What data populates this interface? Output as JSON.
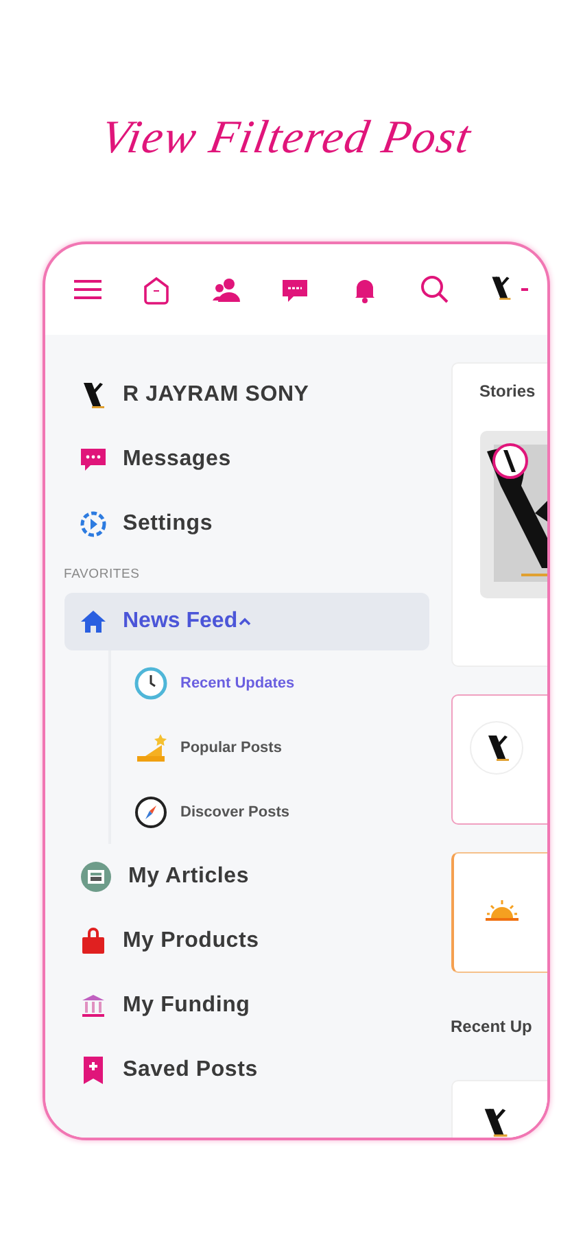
{
  "title": "View Filtered Post",
  "sidebar": {
    "profile": {
      "name": "R JAYRAM SONY"
    },
    "top_items": [
      {
        "label": "Messages"
      },
      {
        "label": "Settings"
      }
    ],
    "section_label": "FAVORITES",
    "feed": {
      "label": "News Feed",
      "selected": true,
      "expanded": true,
      "children": [
        {
          "label": "Recent Updates",
          "selected": true
        },
        {
          "label": "Popular Posts",
          "selected": false
        },
        {
          "label": "Discover Posts",
          "selected": false
        }
      ]
    },
    "bottom_items": [
      {
        "label": "My Articles"
      },
      {
        "label": "My Products"
      },
      {
        "label": "My Funding"
      },
      {
        "label": "Saved Posts"
      }
    ]
  },
  "feed_panel": {
    "stories_heading": "Stories",
    "recent_heading": "Recent Up"
  }
}
